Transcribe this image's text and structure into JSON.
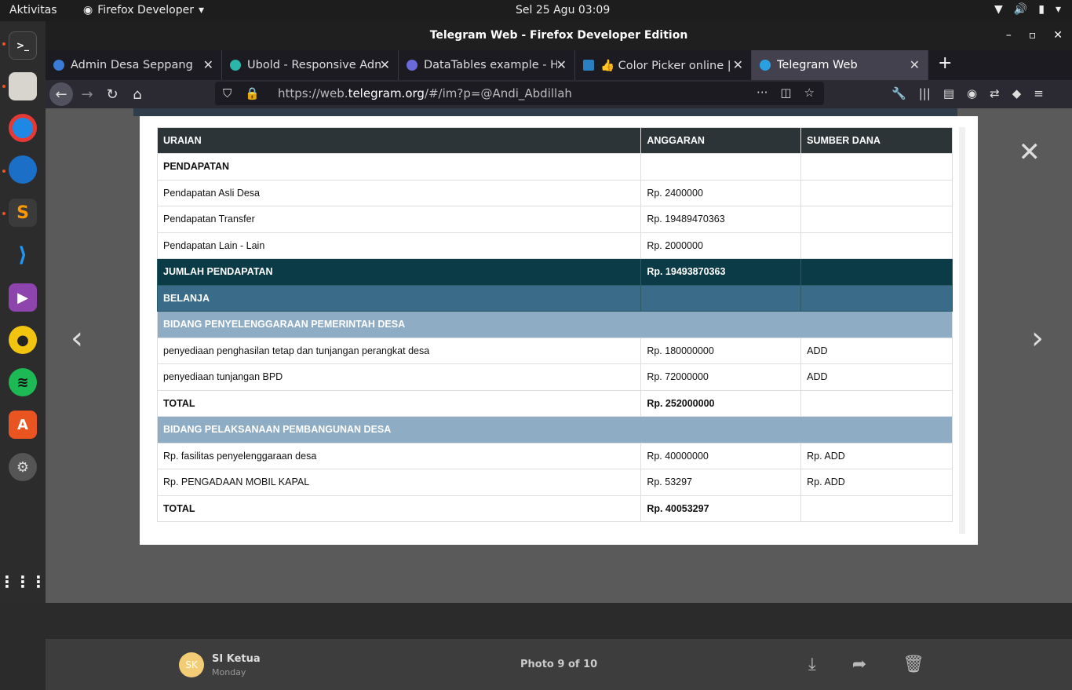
{
  "topbar": {
    "activities": "Aktivitas",
    "app": "Firefox Developer",
    "clock": "Sel 25 Agu  03:09"
  },
  "window": {
    "title": "Telegram Web - Firefox Developer Edition"
  },
  "tabs": [
    {
      "label": "Admin Desa Seppang",
      "color": "#3a7bd5"
    },
    {
      "label": "Ubold - Responsive Admin",
      "color": "#2ab6a8"
    },
    {
      "label": "DataTables example - Hi",
      "color": "#6a6ad8"
    },
    {
      "label": "👍 Color Picker online | H",
      "color": "#2a7fc0"
    },
    {
      "label": "Telegram Web",
      "color": "#2aa0e0"
    }
  ],
  "url": {
    "prefix": "https://web.",
    "domain": "telegram.org",
    "rest": "/#/im?p=@Andi_Abdillah"
  },
  "table": {
    "headers": [
      "URAIAN",
      "ANGGARAN",
      "SUMBER DANA"
    ],
    "rows": [
      {
        "type": "bold",
        "cells": [
          "PENDAPATAN",
          "",
          ""
        ]
      },
      {
        "type": "normal",
        "cells": [
          "Pendapatan Asli Desa",
          "Rp. 2400000",
          ""
        ]
      },
      {
        "type": "normal",
        "cells": [
          "Pendapatan Transfer",
          "Rp. 19489470363",
          ""
        ]
      },
      {
        "type": "normal",
        "cells": [
          "Pendapatan Lain - Lain",
          "Rp. 2000000",
          ""
        ]
      },
      {
        "type": "jum",
        "cells": [
          "JUMLAH PENDAPATAN",
          "Rp. 19493870363",
          ""
        ]
      },
      {
        "type": "bel",
        "cells": [
          "BELANJA",
          "",
          ""
        ]
      },
      {
        "type": "bid",
        "cells": [
          "BIDANG PENYELENGGARAAN PEMERINTAH DESA"
        ]
      },
      {
        "type": "normal",
        "cells": [
          "penyediaan penghasilan tetap dan tunjangan perangkat desa",
          "Rp. 180000000",
          "ADD"
        ]
      },
      {
        "type": "normal",
        "cells": [
          "penyediaan tunjangan BPD",
          "Rp. 72000000",
          "ADD"
        ]
      },
      {
        "type": "bold",
        "cells": [
          "TOTAL",
          "Rp. 252000000",
          ""
        ]
      },
      {
        "type": "bid",
        "cells": [
          "BIDANG PELAKSANAAN PEMBANGUNAN DESA"
        ]
      },
      {
        "type": "normal",
        "cells": [
          "Rp. fasilitas penyelenggaraan desa",
          "Rp. 40000000",
          "Rp. ADD"
        ]
      },
      {
        "type": "normal",
        "cells": [
          "Rp. PENGADAAN MOBIL KAPAL",
          "Rp. 53297",
          "Rp. ADD"
        ]
      },
      {
        "type": "bold",
        "cells": [
          "TOTAL",
          "Rp. 40053297",
          ""
        ]
      }
    ]
  },
  "footer": {
    "initials": "SK",
    "name": "SI Ketua",
    "date": "Monday",
    "count": "Photo 9 of 10"
  }
}
